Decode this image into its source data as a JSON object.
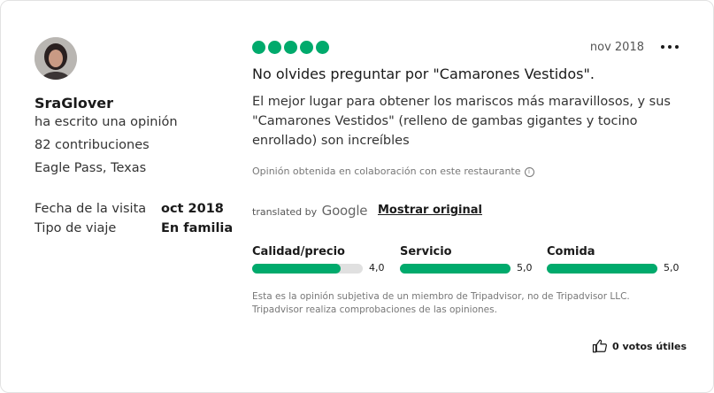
{
  "reviewer": {
    "name": "SraGlover",
    "action": "ha escrito una opinión",
    "contributions": "82 contribuciones",
    "location": "Eagle Pass, Texas",
    "avatar_icon": "user-avatar-photo"
  },
  "visit": {
    "date_label": "Fecha de la visita",
    "date_value": "oct 2018",
    "trip_label": "Tipo de viaje",
    "trip_value": "En familia"
  },
  "review": {
    "rating_bubbles": 5,
    "rating_color": "#00aa6c",
    "date": "nov 2018",
    "title": "No olvides preguntar por \"Camarones Vestidos\".",
    "body": "El mejor lugar para obtener los mariscos más maravillosos, y sus \"Camarones Vestidos\" (relleno de gambas gigantes y tocino enrollado) son increíbles",
    "collab_note": "Opinión obtenida en colaboración con este restaurante",
    "info_icon": "i",
    "translated_by": "translated by",
    "google_label": "Google",
    "show_original": "Mostrar original"
  },
  "subratings": [
    {
      "label": "Calidad/precio",
      "value": "4,0",
      "fraction": 0.8
    },
    {
      "label": "Servicio",
      "value": "5,0",
      "fraction": 1.0
    },
    {
      "label": "Comida",
      "value": "5,0",
      "fraction": 1.0
    }
  ],
  "disclaimer": "Esta es la opinión subjetiva de un miembro de Tripadvisor, no de Tripadvisor LLC. Tripadvisor realiza comprobaciones de las opiniones.",
  "helpful": {
    "label": "0 votos útiles",
    "icon": "thumbs-up-icon"
  },
  "menu_icon": "more-options-icon"
}
